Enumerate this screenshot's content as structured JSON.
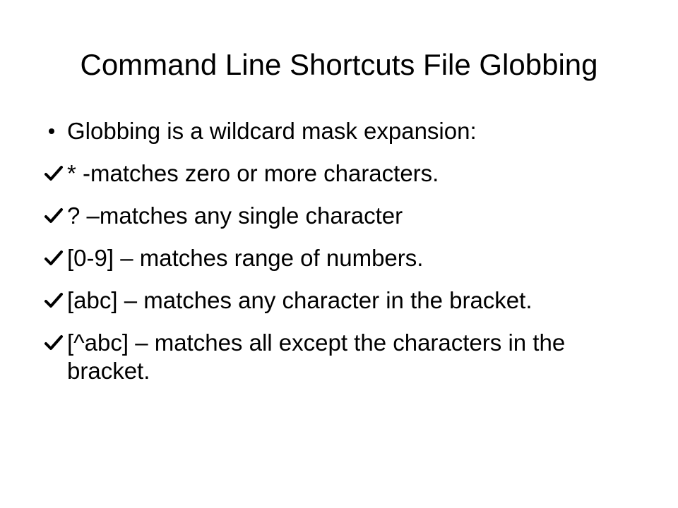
{
  "slide": {
    "title": "Command Line Shortcuts File Globbing",
    "items": [
      {
        "marker": "bullet-dot-icon",
        "text": "Globbing is a wildcard mask expansion:"
      },
      {
        "marker": "checkmark-icon",
        "text": "* -matches zero or more characters."
      },
      {
        "marker": "checkmark-icon",
        "text": "? –matches any single character"
      },
      {
        "marker": "checkmark-icon",
        "text": "[0-9] – matches range of numbers."
      },
      {
        "marker": "checkmark-icon",
        "text": "[abc] – matches any character in the bracket."
      },
      {
        "marker": "checkmark-icon",
        "text": "[^abc] – matches all except the characters in the bracket."
      }
    ]
  }
}
